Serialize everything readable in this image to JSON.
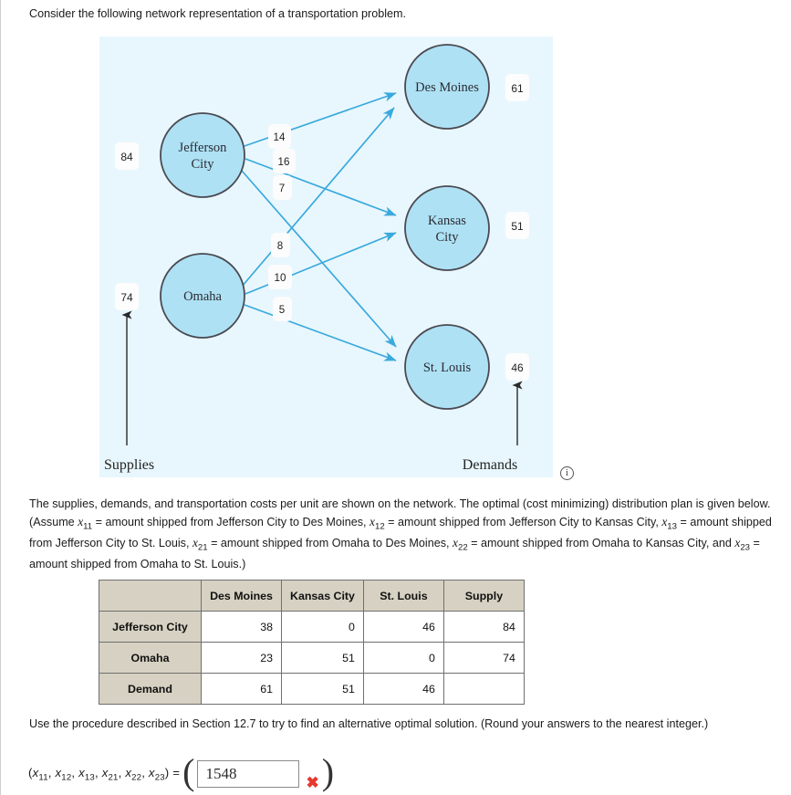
{
  "intro": {
    "text": "Consider the following network representation of a transportation problem."
  },
  "diagram": {
    "background_color": "#e8f7fd",
    "node_fill": "#aee1f4",
    "node_stroke": "#4a4a52",
    "edge_color": "#3aa9dd",
    "supply_axis_label": "Supplies",
    "demand_axis_label": "Demands",
    "info_icon_label": "i",
    "sources": [
      {
        "name": "Jefferson City",
        "line1": "Jefferson",
        "line2": "City",
        "supply": "84"
      },
      {
        "name": "Omaha",
        "line1": "Omaha",
        "line2": "",
        "supply": "74"
      }
    ],
    "destinations": [
      {
        "name": "Des Moines",
        "line1": "Des Moines",
        "line2": "",
        "demand": "61"
      },
      {
        "name": "Kansas City",
        "line1": "Kansas",
        "line2": "City",
        "demand": "51"
      },
      {
        "name": "St. Louis",
        "line1": "St. Louis",
        "line2": "",
        "demand": "46"
      }
    ],
    "costs": [
      {
        "from": "Jefferson City",
        "to": "Des Moines",
        "cost": "14"
      },
      {
        "from": "Jefferson City",
        "to": "Kansas City",
        "cost": "16"
      },
      {
        "from": "Jefferson City",
        "to": "St. Louis",
        "cost": "7"
      },
      {
        "from": "Omaha",
        "to": "Des Moines",
        "cost": "8"
      },
      {
        "from": "Omaha",
        "to": "Kansas City",
        "cost": "10"
      },
      {
        "from": "Omaha",
        "to": "St. Louis",
        "cost": "5"
      }
    ]
  },
  "paragraph": {
    "s1": "The supplies, demands, and transportation costs per unit are shown on the network. The optimal (cost minimizing) distribution plan is given below. (Assume ",
    "v11": "x",
    "v11sub": "11",
    "s2": " = amount shipped from Jefferson City to Des Moines, ",
    "v12": "x",
    "v12sub": "12",
    "s3": " = amount shipped from Jefferson City to Kansas City, ",
    "v13": "x",
    "v13sub": "13",
    "s4": " = amount shipped from Jefferson City to St. Louis, ",
    "v21": "x",
    "v21sub": "21",
    "s5": " = amount shipped from Omaha to Des Moines, ",
    "v22": "x",
    "v22sub": "22",
    "s6": " = amount shipped from Omaha to Kansas City, and ",
    "v23": "x",
    "v23sub": "23",
    "s7": " = amount shipped from Omaha to St. Louis.)"
  },
  "table": {
    "corner": "",
    "columns": [
      "Des Moines",
      "Kansas City",
      "St. Louis",
      "Supply"
    ],
    "rows": [
      {
        "label": "Jefferson City",
        "cells": [
          "38",
          "0",
          "46",
          "84"
        ]
      },
      {
        "label": "Omaha",
        "cells": [
          "23",
          "51",
          "0",
          "74"
        ]
      },
      {
        "label": "Demand",
        "cells": [
          "61",
          "51",
          "46",
          ""
        ]
      }
    ]
  },
  "question": {
    "text": "Use the procedure described in Section 12.7 to try to find an alternative optimal solution. (Round your answers to the nearest integer.)",
    "tuple_prefix": "(",
    "tuple_vars": [
      {
        "v": "x",
        "sub": "11"
      },
      {
        "v": "x",
        "sub": "12"
      },
      {
        "v": "x",
        "sub": "13"
      },
      {
        "v": "x",
        "sub": "21"
      },
      {
        "v": "x",
        "sub": "22"
      },
      {
        "v": "x",
        "sub": "23"
      }
    ],
    "tuple_suffix": ") =",
    "answer_value": "1548",
    "answer_placeholder": "",
    "status_mark": "✖",
    "status_color": "#e8392f"
  }
}
